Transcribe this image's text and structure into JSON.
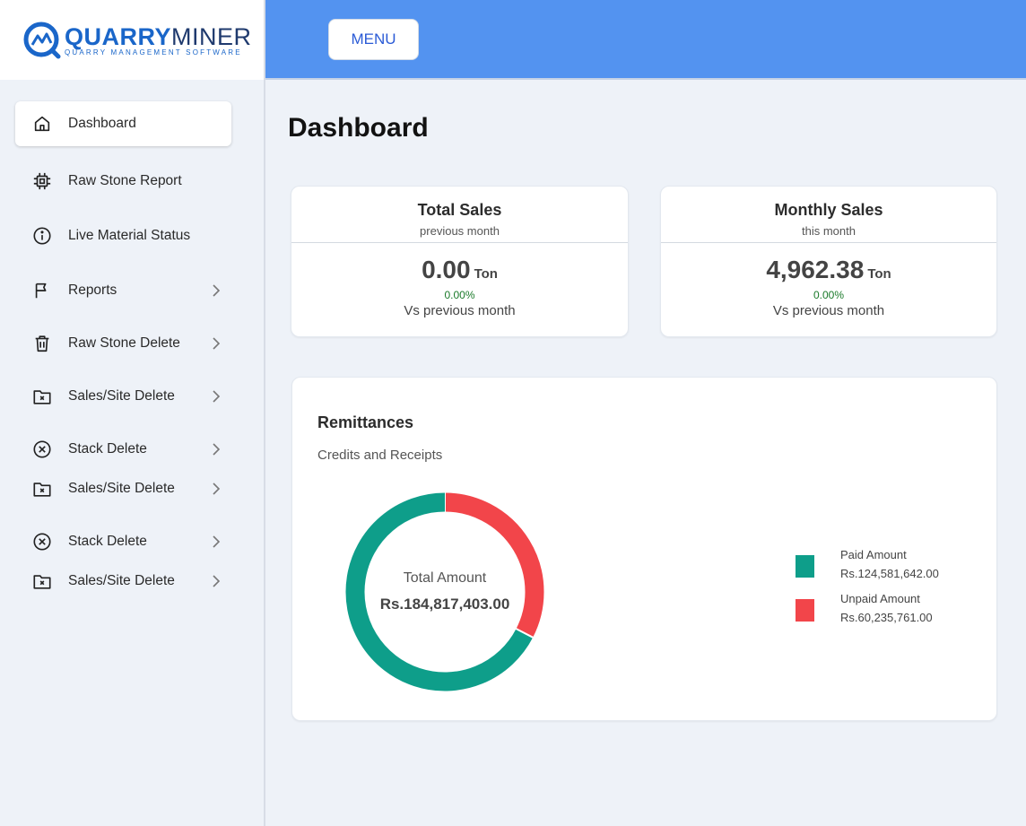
{
  "brand": {
    "name_part1": "QUARRY",
    "name_part2": "MINER",
    "tagline": "QUARRY MANAGEMENT SOFTWARE",
    "primary_color": "#1a66c9",
    "secondary_color": "#1f3a6e"
  },
  "header": {
    "menu_label": "MENU",
    "bar_color": "#5393f0"
  },
  "sidebar": {
    "items": [
      {
        "label": "Dashboard",
        "icon": "home-icon",
        "active": true,
        "has_submenu": false
      },
      {
        "label": "Raw Stone Report",
        "icon": "chip-icon",
        "active": false,
        "has_submenu": false
      },
      {
        "label": "Live Material Status",
        "icon": "info-icon",
        "active": false,
        "has_submenu": false
      },
      {
        "label": "Reports",
        "icon": "flag-icon",
        "active": false,
        "has_submenu": true
      },
      {
        "label": "Raw Stone Delete",
        "icon": "trash-icon",
        "active": false,
        "has_submenu": true
      },
      {
        "label": "Sales/Site Delete",
        "icon": "folder-x-icon",
        "active": false,
        "has_submenu": true
      },
      {
        "label": "Stack Delete",
        "icon": "circle-x-icon",
        "active": false,
        "has_submenu": true
      },
      {
        "label": "Sales/Site Delete",
        "icon": "folder-x-icon",
        "active": false,
        "has_submenu": true
      },
      {
        "label": "Stack Delete",
        "icon": "circle-x-icon",
        "active": false,
        "has_submenu": true
      },
      {
        "label": "Sales/Site Delete",
        "icon": "folder-x-icon",
        "active": false,
        "has_submenu": true
      }
    ]
  },
  "main": {
    "page_title": "Dashboard",
    "cards": [
      {
        "title": "Total Sales",
        "subtitle": "previous month",
        "value": "0.00",
        "unit": "Ton",
        "pct": "0.00%",
        "compare": "Vs previous month"
      },
      {
        "title": "Monthly Sales",
        "subtitle": "this month",
        "value": "4,962.38",
        "unit": "Ton",
        "pct": "0.00%",
        "compare": "Vs previous month"
      }
    ],
    "remittances": {
      "title": "Remittances",
      "subtitle": "Credits and Receipts",
      "center_label": "Total Amount",
      "center_total": "Rs.184,817,403.00",
      "legend": [
        {
          "name": "Paid Amount",
          "value": "Rs.124,581,642.00",
          "color": "#0e9e8a"
        },
        {
          "name": "Unpaid Amount",
          "value": "Rs.60,235,761.00",
          "color": "#f2454a"
        }
      ]
    }
  },
  "chart_data": {
    "type": "pie",
    "title": "Remittances",
    "subtitle": "Credits and Receipts",
    "categories": [
      "Paid Amount",
      "Unpaid Amount"
    ],
    "values": [
      124581642.0,
      60235761.0
    ],
    "colors": [
      "#0e9e8a",
      "#f2454a"
    ],
    "donut": true,
    "legend_position": "right"
  }
}
